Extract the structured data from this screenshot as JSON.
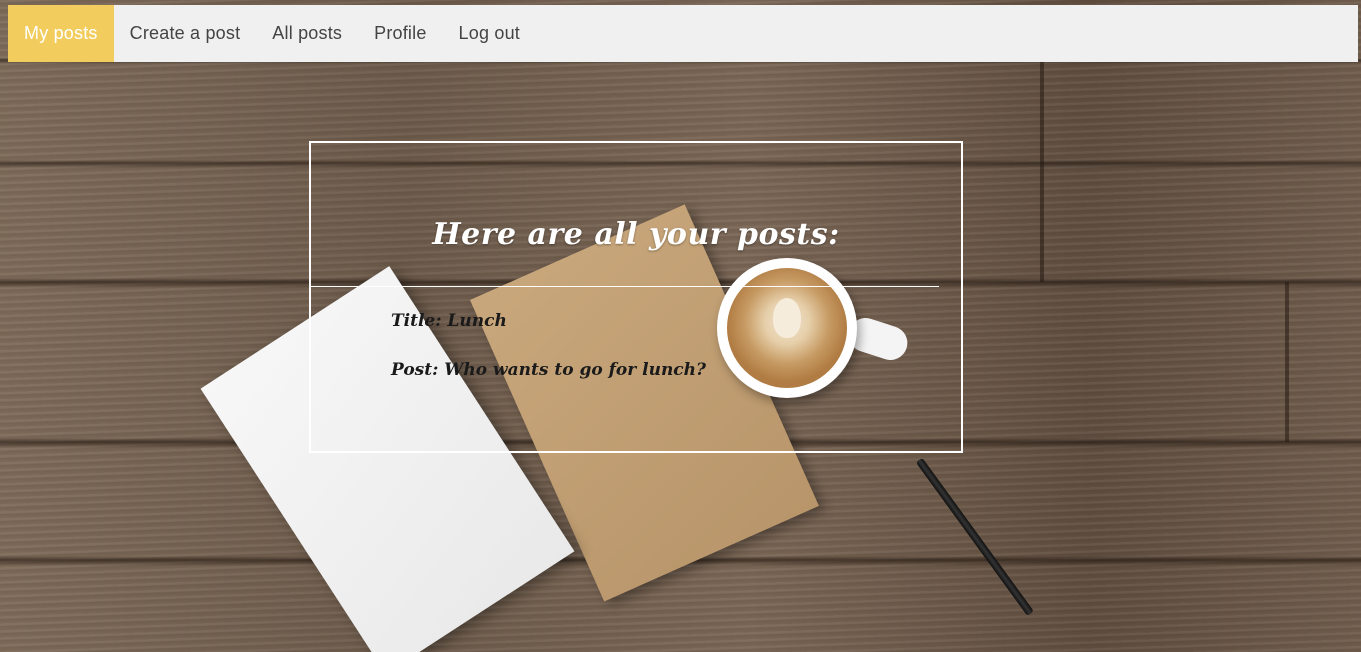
{
  "nav": {
    "items": [
      {
        "label": "My posts",
        "active": true
      },
      {
        "label": "Create a post",
        "active": false
      },
      {
        "label": "All posts",
        "active": false
      },
      {
        "label": "Profile",
        "active": false
      },
      {
        "label": "Log out",
        "active": false
      }
    ]
  },
  "main": {
    "heading": "Here are all your posts:",
    "posts": [
      {
        "title_line": "Title: Lunch",
        "body_line": "Post: Who wants to go for lunch?"
      }
    ]
  },
  "colors": {
    "nav_background": "#f0f0f0",
    "nav_active": "#f2cd5e",
    "nav_text": "#444444",
    "frame_border": "#ffffff"
  }
}
